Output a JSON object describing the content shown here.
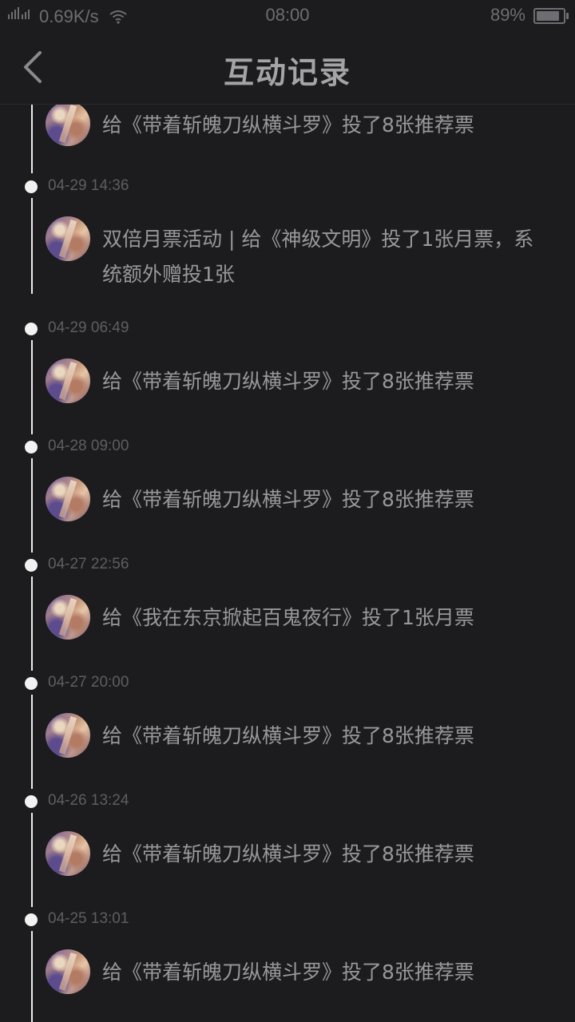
{
  "status_bar": {
    "network_text": "0.69K/s",
    "signal_labels": [
      "2G",
      "3G"
    ],
    "time": "08:00",
    "battery_percent_text": "89%",
    "battery_level": 0.89
  },
  "header": {
    "back_icon": "chevron-left-icon",
    "title": "互动记录"
  },
  "records": [
    {
      "time": "",
      "text": "给《带着斩魄刀纵横斗罗》投了8张推荐票"
    },
    {
      "time": "04-29 14:36",
      "text": "双倍月票活动 | 给《神级文明》投了1张月票，系统额外赠投1张"
    },
    {
      "time": "04-29 06:49",
      "text": "给《带着斩魄刀纵横斗罗》投了8张推荐票"
    },
    {
      "time": "04-28 09:00",
      "text": "给《带着斩魄刀纵横斗罗》投了8张推荐票"
    },
    {
      "time": "04-27 22:56",
      "text": "给《我在东京掀起百鬼夜行》投了1张月票"
    },
    {
      "time": "04-27 20:00",
      "text": "给《带着斩魄刀纵横斗罗》投了8张推荐票"
    },
    {
      "time": "04-26 13:24",
      "text": "给《带着斩魄刀纵横斗罗》投了8张推荐票"
    },
    {
      "time": "04-25 13:01",
      "text": "给《带着斩魄刀纵横斗罗》投了8张推荐票"
    }
  ]
}
